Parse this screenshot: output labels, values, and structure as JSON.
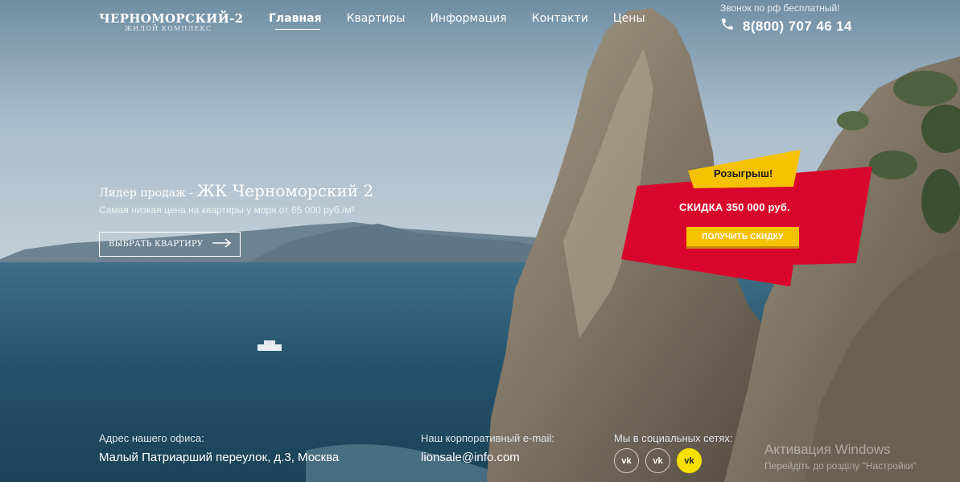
{
  "colors": {
    "accent_red": "#d8062c",
    "accent_yellow": "#f6c200",
    "sea": "#2c5d77",
    "sky": "#9db2c0"
  },
  "logo": {
    "main": "ЧЕРНОМОРСКИЙ-2",
    "sub": "ЖИЛОЙ КОМПЛЕКС"
  },
  "nav": {
    "items": [
      {
        "label": "Главная",
        "active": true
      },
      {
        "label": "Квартиры",
        "active": false
      },
      {
        "label": "Информация",
        "active": false
      },
      {
        "label": "Контакти",
        "active": false
      },
      {
        "label": "Цены",
        "active": false
      }
    ]
  },
  "contact": {
    "call_free": "Звонок по рф бесплатный!",
    "phone": "8(800) 707 46 14",
    "phone_icon": "phone-icon"
  },
  "hero": {
    "title_prefix": "Лидер продаж - ",
    "title_strong": "ЖК Черноморский 2",
    "subtitle": "Самая низкая цена на квартиры у моря от 65 000 руб./м²",
    "button_label": "ВЫБРАТЬ КВАРТИРУ",
    "button_icon": "arrow-right-icon"
  },
  "promo": {
    "label": "Розыгрыш!",
    "discount": "СКИДКА 350 000 руб.",
    "button_label": "ПОЛУЧИТЬ СКИДКУ"
  },
  "footer": {
    "office_label": "Адрес нашего офиса:",
    "office_value": "Малый Патриарший переулок, д.3, Москва",
    "email_label": "Наш корпоративный e-mail:",
    "email_value": "lionsale@info.com",
    "social_label": "Мы в социальных сетях:",
    "socials": [
      {
        "icon": "vk-icon",
        "text": "vk"
      },
      {
        "icon": "vk-icon",
        "text": "vk"
      },
      {
        "icon": "vk-icon",
        "text": "vk"
      }
    ]
  },
  "watermark": {
    "line1": "Активация Windows",
    "line2": "Перейдіть до розділу \"Настройки\""
  }
}
